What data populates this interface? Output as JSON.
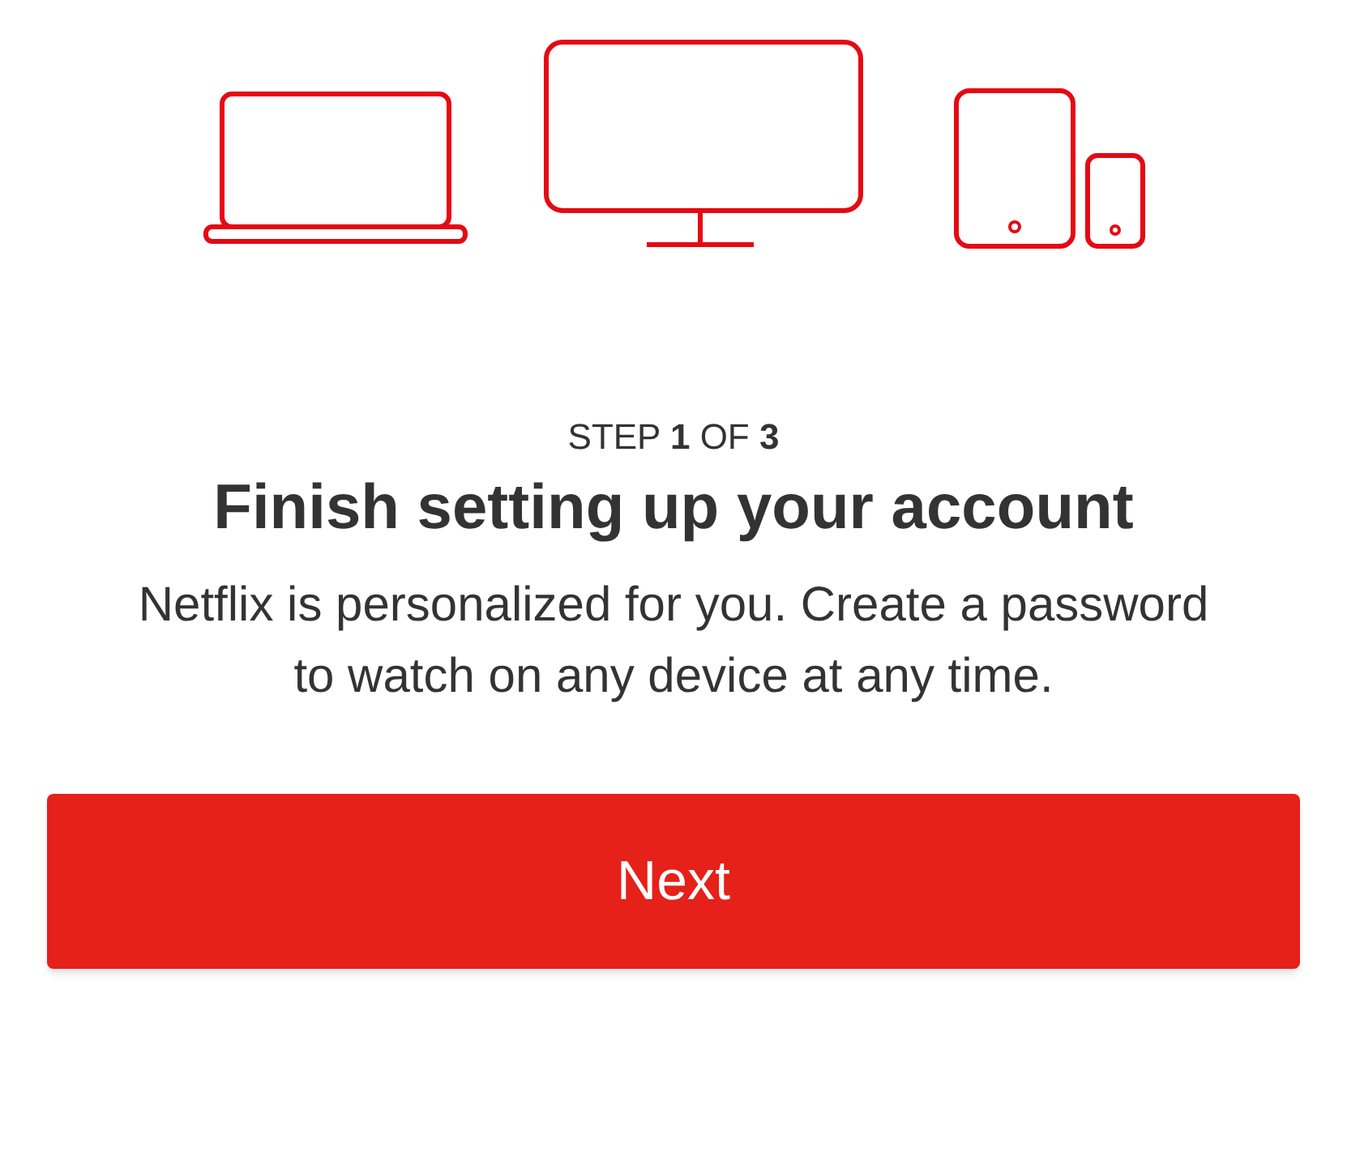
{
  "step": "STEP **1** OF **3**",
  "title": "Finish setting up your account",
  "description": "Netflix is personalized for you. Create a password to watch on any device at any time.",
  "button": "Next"
}
